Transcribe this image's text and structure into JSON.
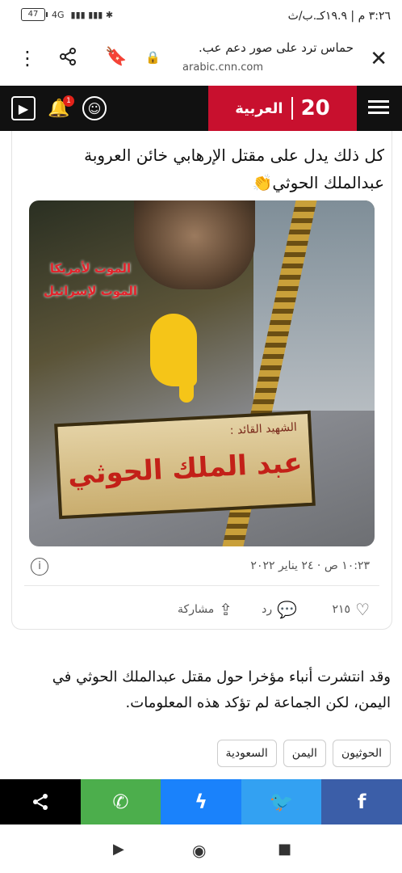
{
  "status": {
    "time": "٣:٢٦ م | ١٩.٩كـ.ب/ث",
    "battery": "47",
    "network": "4G"
  },
  "urlbar": {
    "title": "حماس ترد على صور دعم عب.",
    "domain": "arabic.cnn.com"
  },
  "site": {
    "logo_number": "20",
    "logo_brand": "العربية",
    "notification_count": "1"
  },
  "tweet": {
    "text": "كل ذلك يدل على مقتل الإرهابي خائن العروبة عبدالملك الحوثي👏",
    "image_slogan_1": "الموت لأمريكا",
    "image_slogan_2": "الموت لإسرائيل",
    "image_plaque_sub": "الشهيد القائد :",
    "image_plaque_name": "عبد الملك الحوثي",
    "date": "١٠:٢٣ ص · ٢٤ يناير ٢٠٢٢",
    "likes": "٢١٥",
    "reply_label": "رد",
    "share_label": "مشاركة"
  },
  "article": {
    "paragraph": "وقد انتشرت أنباء مؤخرا حول مقتل عبدالملك الحوثي في اليمن، لكن الجماعة لم تؤكد هذه المعلومات."
  },
  "tags": [
    "السعودية",
    "اليمن",
    "الحوثيون"
  ],
  "sharebar": {
    "colors": {
      "share": "#000000",
      "whatsapp": "#4cae4c",
      "messenger": "#1a82fb",
      "twitter": "#33a1f2",
      "facebook": "#3b5ea8"
    }
  }
}
